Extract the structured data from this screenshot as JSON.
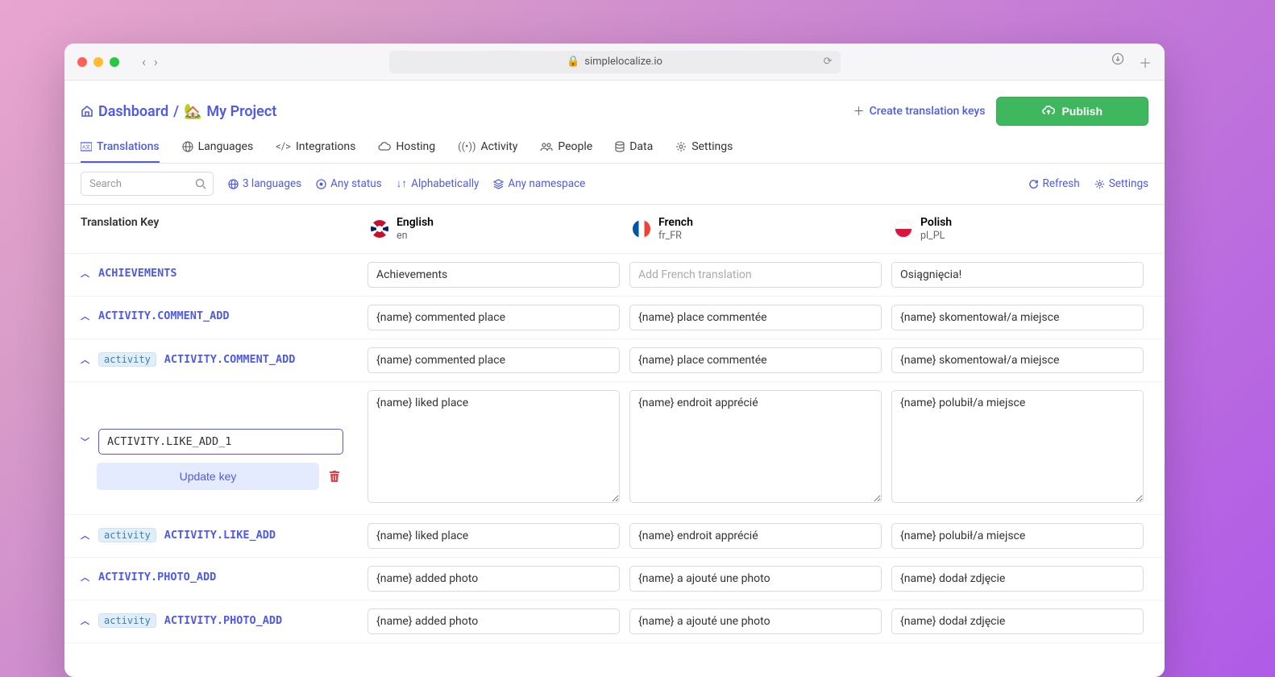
{
  "browser": {
    "url": "simplelocalize.io"
  },
  "breadcrumb": {
    "dashboard": "Dashboard",
    "separator": "/",
    "project_emoji": "🏡",
    "project_name": "My Project"
  },
  "header_actions": {
    "create_keys": "Create translation keys",
    "publish": "Publish"
  },
  "tabs": [
    {
      "label": "Translations"
    },
    {
      "label": "Languages"
    },
    {
      "label": "Integrations"
    },
    {
      "label": "Hosting"
    },
    {
      "label": "Activity"
    },
    {
      "label": "People"
    },
    {
      "label": "Data"
    },
    {
      "label": "Settings"
    }
  ],
  "filters": {
    "search_placeholder": "Search",
    "languages": "3 languages",
    "status": "Any status",
    "sort": "Alphabetically",
    "namespace": "Any namespace",
    "refresh": "Refresh",
    "settings": "Settings"
  },
  "columns": {
    "key_header": "Translation Key",
    "langs": [
      {
        "name": "English",
        "code": "en"
      },
      {
        "name": "French",
        "code": "fr_FR"
      },
      {
        "name": "Polish",
        "code": "pl_PL"
      }
    ]
  },
  "edit_box": {
    "key_value": "ACTIVITY.LIKE_ADD_1",
    "update_label": "Update key"
  },
  "rows": [
    {
      "key": "ACHIEVEMENTS",
      "ns": null,
      "en": "Achievements",
      "fr": "",
      "fr_placeholder": "Add French translation",
      "pl": "Osiągnięcia!"
    },
    {
      "key": "ACTIVITY.COMMENT_ADD",
      "ns": null,
      "en": "{name} commented place",
      "fr": "{name} place commentée",
      "pl": "{name} skomentował/a miejsce"
    },
    {
      "key": "ACTIVITY.COMMENT_ADD",
      "ns": "activity",
      "en": "{name} commented place",
      "fr": "{name} place commentée",
      "pl": "{name} skomentował/a miejsce"
    },
    {
      "key": "__EDITING__",
      "en": "{name} liked place",
      "fr": "{name} endroit apprécié",
      "pl": "{name} polubił/a miejsce"
    },
    {
      "key": "ACTIVITY.LIKE_ADD",
      "ns": "activity",
      "en": "{name} liked place",
      "fr": "{name} endroit apprécié",
      "pl": "{name} polubił/a miejsce"
    },
    {
      "key": "ACTIVITY.PHOTO_ADD",
      "ns": null,
      "en": "{name} added photo",
      "fr": "{name} a ajouté une photo",
      "pl": "{name} dodał zdjęcie"
    },
    {
      "key": "ACTIVITY.PHOTO_ADD",
      "ns": "activity",
      "en": "{name} added photo",
      "fr": "{name} a ajouté une photo",
      "pl": "{name} dodał zdjęcie"
    }
  ]
}
